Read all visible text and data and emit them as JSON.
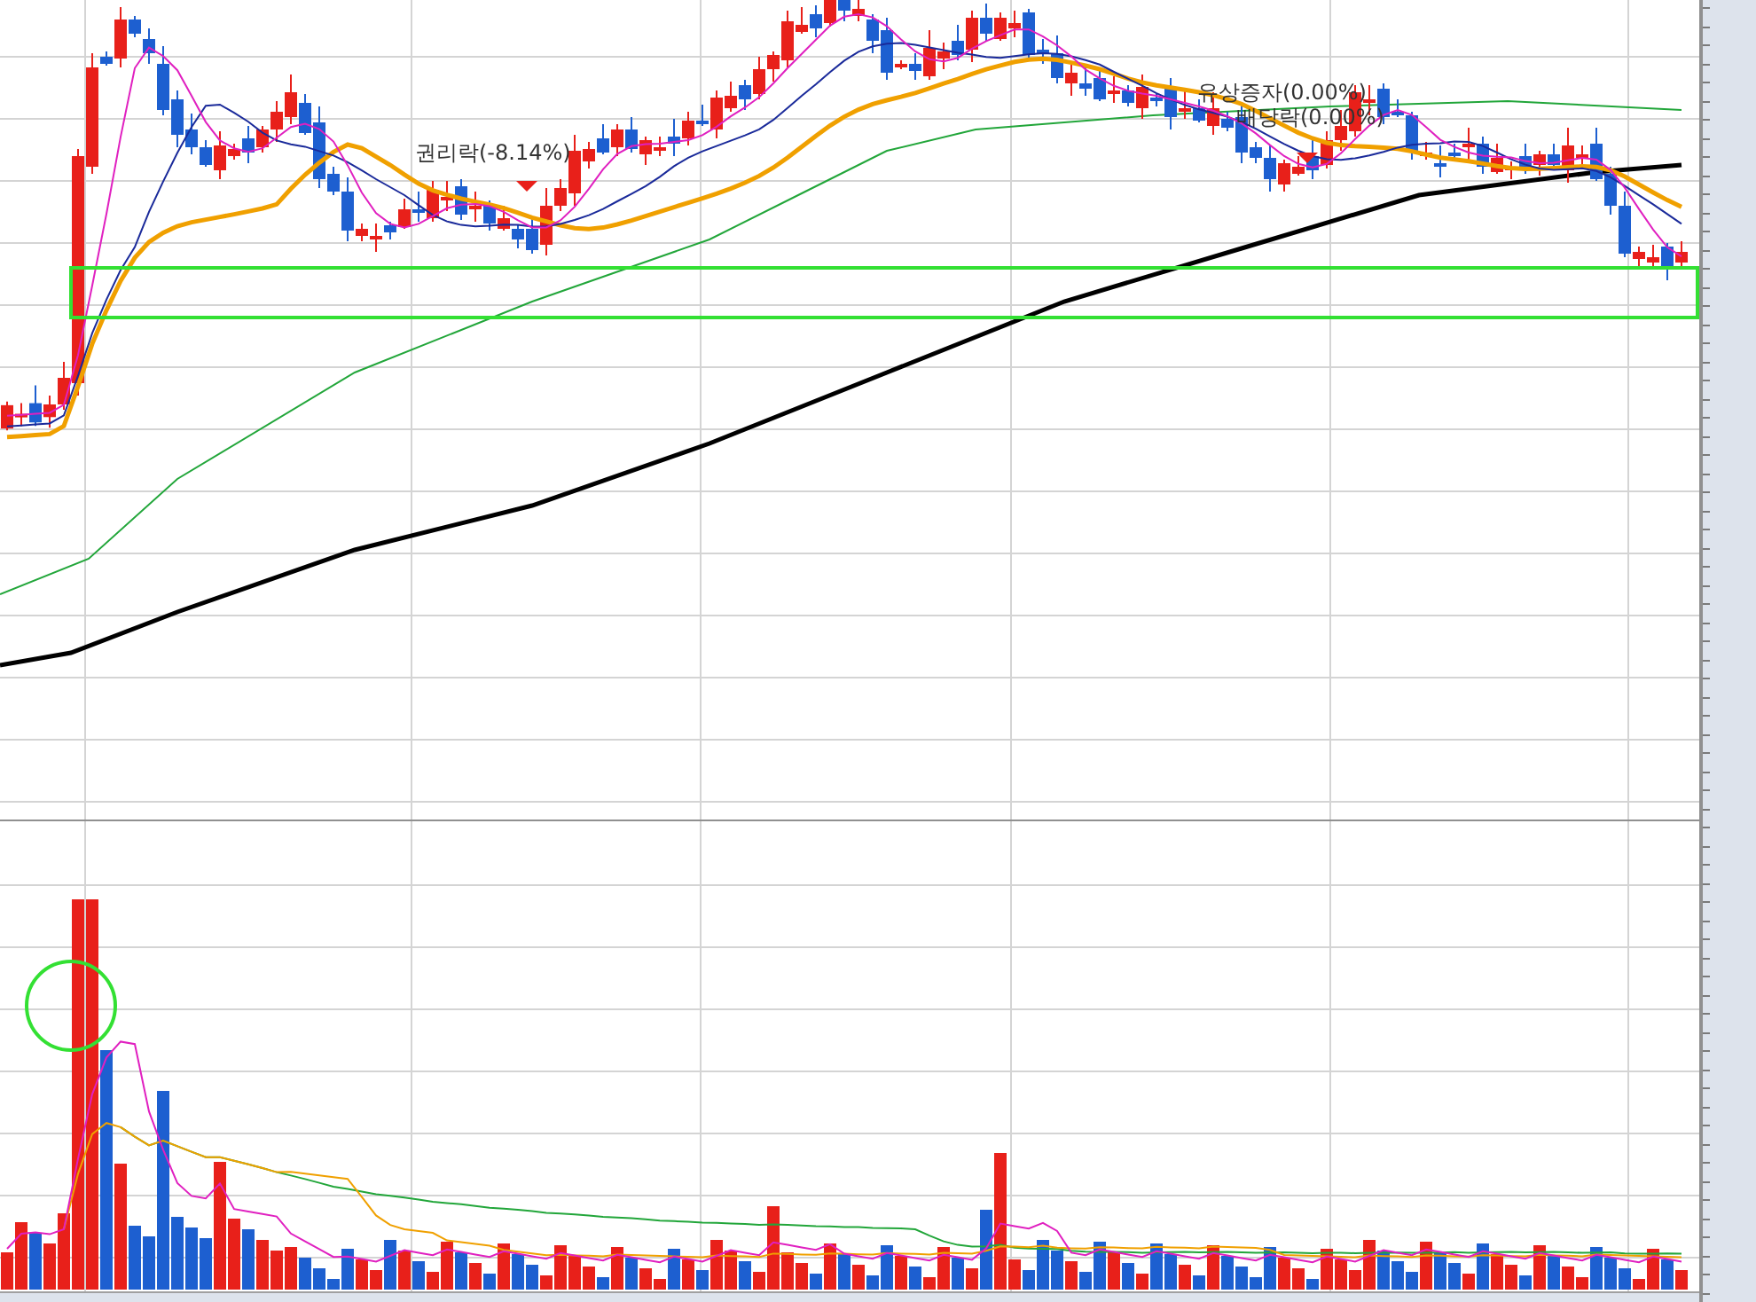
{
  "annotations": [
    {
      "label": "권리락(-8.14%)",
      "kind": "label-arrow"
    },
    {
      "label": "유상증자(0.00%)",
      "kind": "label"
    },
    {
      "label": "배당락(0.00%)",
      "kind": "label-arrow"
    }
  ]
}
